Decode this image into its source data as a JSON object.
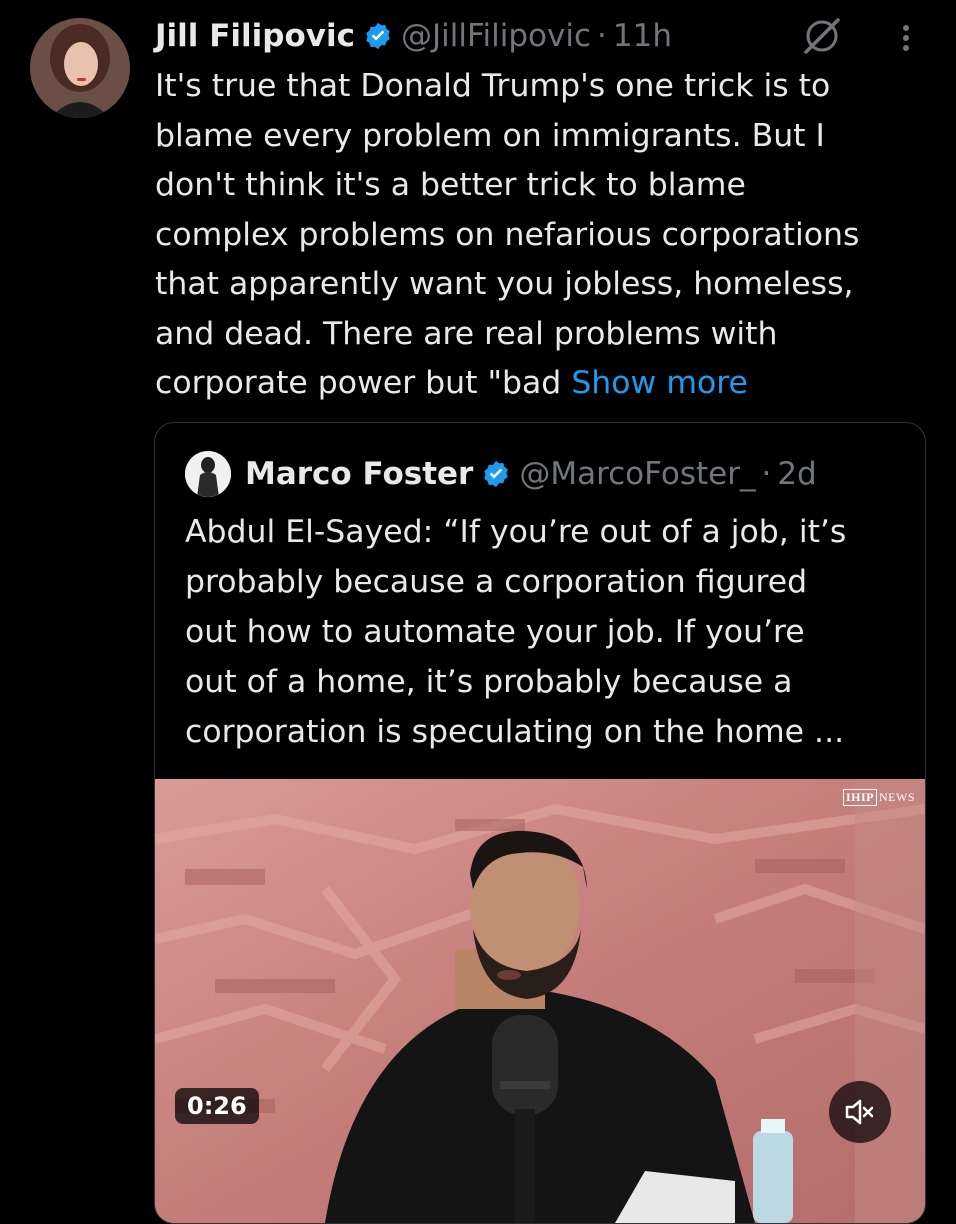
{
  "tweet": {
    "author_name": "Jill Filipovic",
    "handle": "@JillFilipovic",
    "separator": "·",
    "time": "11h",
    "text_lines": [
      "It's true that Donald Trump's one trick is to",
      "blame every problem on immigrants. But I",
      "don't think it's a better trick to blame",
      "complex problems on nefarious corporations",
      "that apparently want you jobless, homeless,",
      "and dead. There are real problems with",
      "corporate power but \"bad "
    ],
    "show_more": "Show more"
  },
  "quote": {
    "author_name": "Marco Foster",
    "handle": "@MarcoFoster_",
    "separator": "·",
    "time": "2d",
    "text_lines": [
      "Abdul El-Sayed: “If you’re out of a job, it’s",
      "probably because a corporation figured",
      "out how to automate your job. If you’re",
      "out of a home, it’s probably because a",
      "corporation is speculating on the home ..."
    ],
    "video": {
      "logo_box": "IHIP",
      "logo_text": "NEWS",
      "timer": "0:26"
    }
  },
  "colors": {
    "background": "#000000",
    "text": "#e7e9ea",
    "secondary": "#71767b",
    "link": "#1d9bf0",
    "border": "#2f3336",
    "verified": "#1d9bf0"
  },
  "icons": {
    "verified": "verified-badge-icon",
    "grok": "grok-icon",
    "more": "more-options-icon",
    "mute": "volume-muted-icon"
  }
}
